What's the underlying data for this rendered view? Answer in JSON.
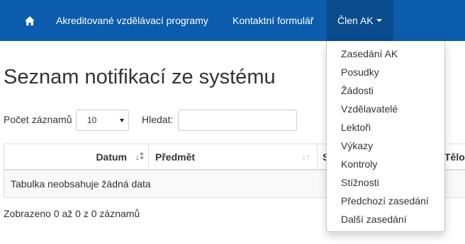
{
  "navbar": {
    "home_icon": "home-icon",
    "programs_label": "Akreditované vzdělávací programy",
    "contact_label": "Kontaktní formulář",
    "member_label": "Člen AK",
    "background": "#0b5cad",
    "active_background": "#0a4c8e"
  },
  "page": {
    "title": "Seznam notifikací ze systému"
  },
  "controls": {
    "count_label": "Počet záznamů",
    "count_value": "10",
    "search_label": "Hledat:",
    "search_value": ""
  },
  "table": {
    "columns": [
      {
        "label": "Datum",
        "sort": "sort-desc-icon"
      },
      {
        "label": "Předmět",
        "sort": "sort-icon"
      },
      {
        "label": "S"
      },
      {
        "label": "Tělo"
      }
    ],
    "empty_message": "Tabulka neobsahuje žádná data",
    "info": "Zobrazeno 0 až 0 z 0 záznamů"
  },
  "dropdown": {
    "items": [
      "Zasedání AK",
      "Posudky",
      "Žádosti",
      "Vzdělavatelé",
      "Lektoři",
      "Výkazy",
      "Kontroly",
      "Stížnosti",
      "Předchozí zasedání",
      "Další zasedání"
    ]
  }
}
